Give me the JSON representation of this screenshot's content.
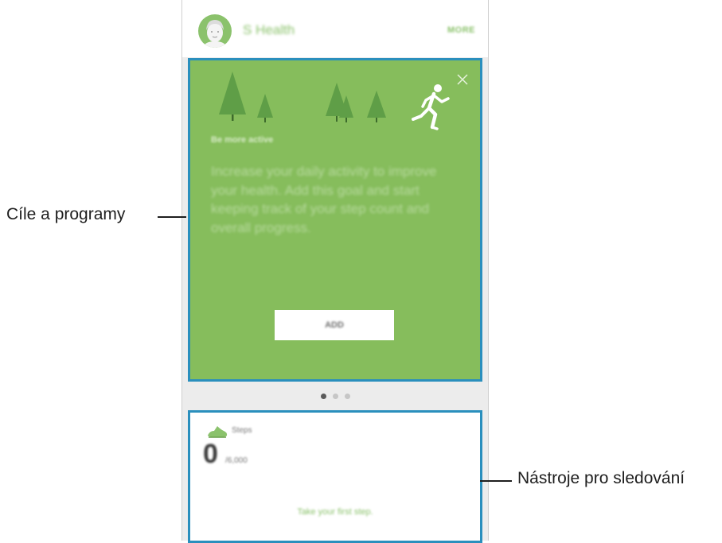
{
  "header": {
    "app_title": "S Health",
    "more_label": "MORE",
    "avatar_icon": "user-avatar-icon"
  },
  "goal_card": {
    "subtitle": "Be more active",
    "description": "Increase your daily activity to improve your health. Add this goal and start keeping track of your step count and overall progress.",
    "add_label": "ADD",
    "accent_color": "#86bd5c",
    "icons": [
      "tree-icon",
      "runner-icon",
      "close-icon"
    ]
  },
  "pager": {
    "count": 3,
    "active_index": 0
  },
  "steps_card": {
    "label": "Steps",
    "count": "0",
    "goal": "/6,000",
    "message": "Take your first step.",
    "icon": "shoe-icon"
  },
  "callouts": {
    "goals": "Cíle a programy",
    "trackers": "Nástroje pro sledování"
  },
  "colors": {
    "highlight": "#2a8fbd",
    "brand_green": "#8bc26c"
  }
}
